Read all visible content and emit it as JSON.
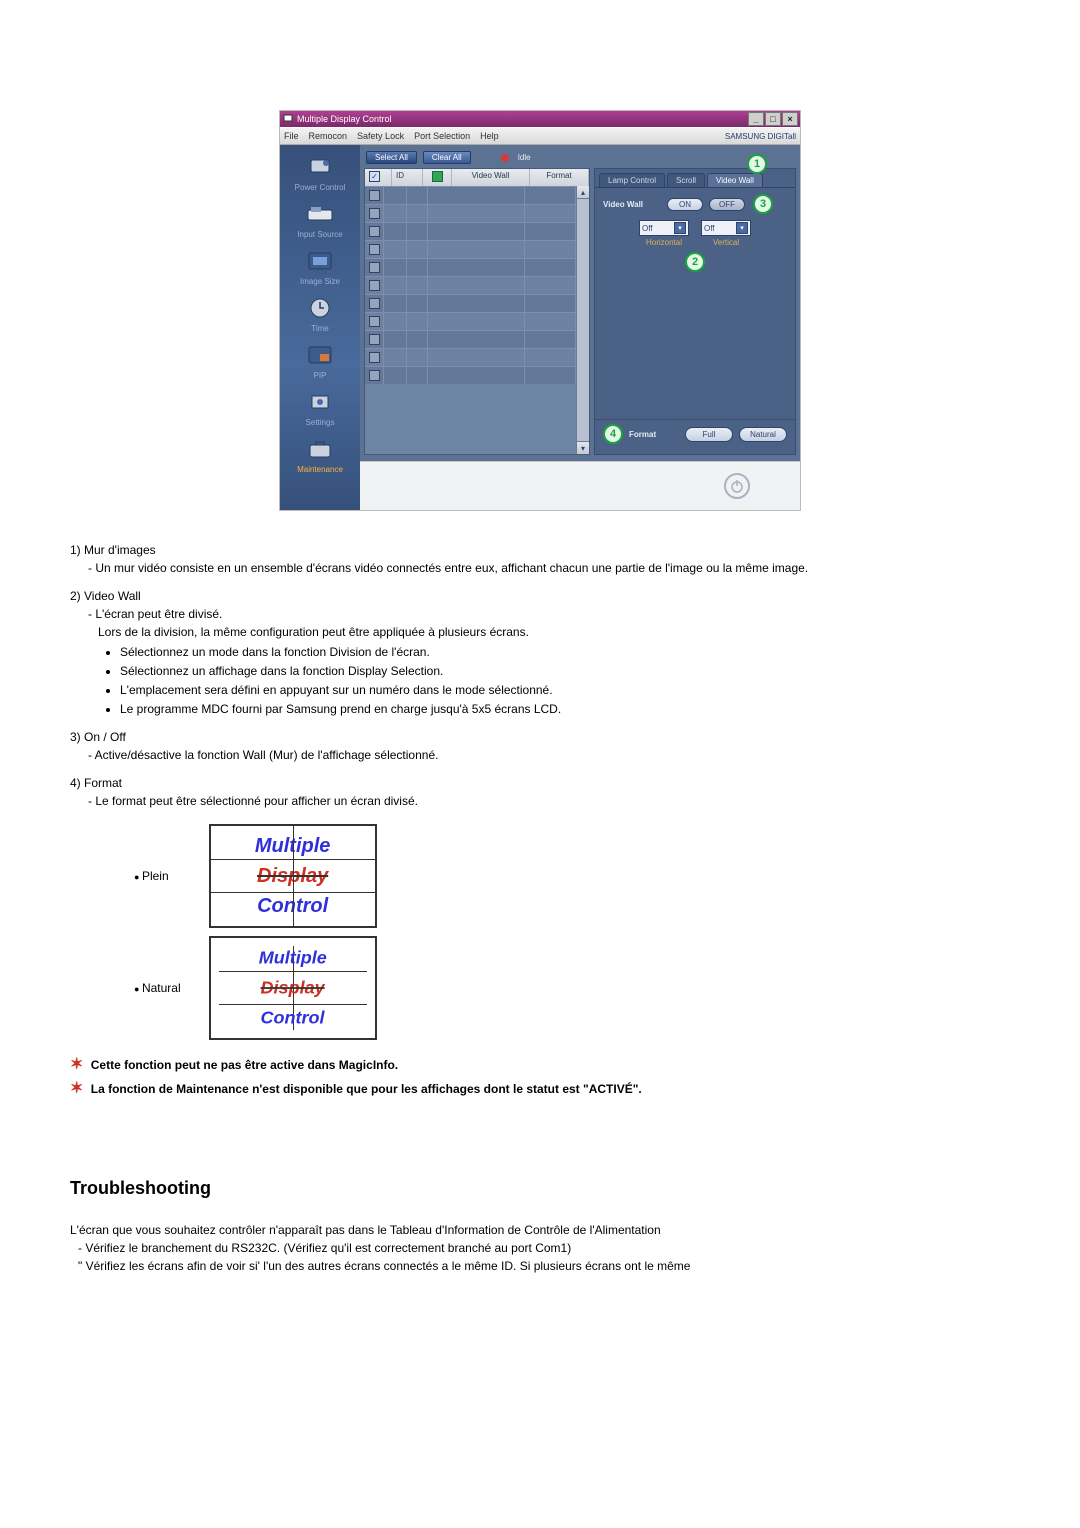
{
  "app": {
    "title": "Multiple Display Control",
    "menubar": [
      "File",
      "Remocon",
      "Safety Lock",
      "Port Selection",
      "Help"
    ],
    "brand": "SAMSUNG DIGITall"
  },
  "sidebar": {
    "items": [
      {
        "label": "Power Control"
      },
      {
        "label": "Input Source"
      },
      {
        "label": "Image Size"
      },
      {
        "label": "Time"
      },
      {
        "label": "PIP"
      },
      {
        "label": "Settings"
      },
      {
        "label": "Maintenance",
        "active": true
      }
    ]
  },
  "toolbar": {
    "select_all": "Select All",
    "clear_all": "Clear All",
    "idle_label": "Idle"
  },
  "grid": {
    "headers": {
      "id": "ID",
      "videowall": "Video Wall",
      "format": "Format"
    }
  },
  "tabs": {
    "items": [
      {
        "label": "Lamp Control"
      },
      {
        "label": "Scroll"
      },
      {
        "label": "Video Wall",
        "active": true
      }
    ]
  },
  "panel": {
    "video_wall_label": "Video Wall",
    "on": "ON",
    "off": "OFF",
    "dropdown_value": "Off",
    "horizontal_label": "Horizontal",
    "vertical_label": "Vertical",
    "format_label": "Format",
    "full": "Full",
    "natural": "Natural"
  },
  "anno": {
    "a1": "1",
    "a2": "2",
    "a3": "3",
    "a4": "4"
  },
  "doc": {
    "items": {
      "i1": {
        "title": "1) Mur d'images",
        "d1": "Un mur vidéo consiste en un ensemble d'écrans vidéo connectés entre eux, affichant chacun une partie de l'image ou la même image."
      },
      "i2": {
        "title": "2)  Video Wall",
        "d1": "L'écran peut être divisé.",
        "d2": "Lors de la division, la même configuration peut être appliquée à plusieurs écrans.",
        "b1": "Sélectionnez un mode dans la fonction Division de l'écran.",
        "b2": "Sélectionnez un affichage dans la fonction Display Selection.",
        "b3": "L'emplacement sera défini en appuyant sur un numéro dans le mode sélectionné.",
        "b4": "Le programme MDC fourni par Samsung prend en charge jusqu'à 5x5 écrans LCD."
      },
      "i3": {
        "title": "3)  On / Off",
        "d1": "Active/désactive la fonction Wall (Mur) de l'affichage sélectionné."
      },
      "i4": {
        "title": "4)  Format",
        "d1": "Le format peut être sélectionné pour afficher un écran divisé."
      }
    },
    "format_labels": {
      "plein": "Plein",
      "natural": "Natural"
    },
    "mdc_lines": {
      "l1": "Multiple",
      "l2": "Display",
      "l3": "Control"
    },
    "notes": {
      "n1": "Cette fonction peut ne pas être active dans MagicInfo.",
      "n2": "La fonction de Maintenance n'est disponible que pour les affichages dont le statut est \"ACTIVÉ\"."
    },
    "troubleshooting_heading": "Troubleshooting",
    "ts": {
      "t1": "L'écran que vous souhaitez contrôler n'apparaît pas dans le Tableau d'Information de Contrôle de l'Alimentation",
      "t1a": "Vérifiez le branchement du RS232C. (Vérifiez qu'il est correctement branché au port Com1)",
      "t1b": "Vérifiez les écrans afin de voir si' l'un des autres écrans connectés a le même ID. Si plusieurs écrans ont le même"
    }
  }
}
